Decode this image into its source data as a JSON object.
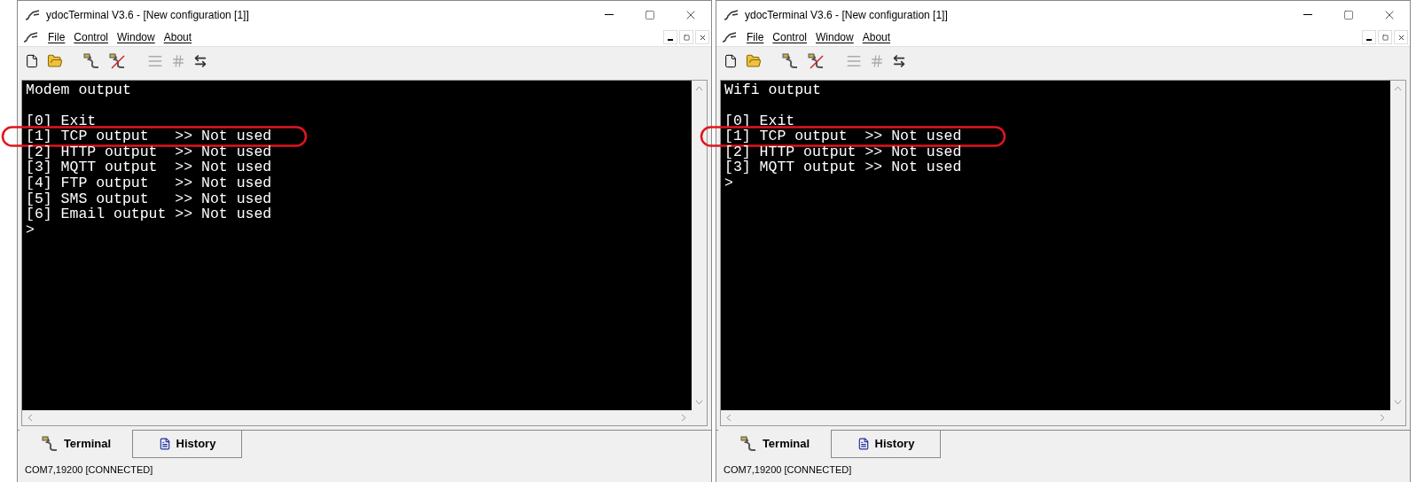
{
  "windows": [
    {
      "title": "ydocTerminal V3.6 - [New configuration [1]]",
      "menu": [
        "File",
        "Control",
        "Window",
        "About"
      ],
      "terminal": {
        "heading": "Modem output",
        "lines": [
          {
            "text": "[0] Exit",
            "circled": false
          },
          {
            "text": "[1] TCP output   >> Not used",
            "circled": true
          },
          {
            "text": "[2] HTTP output  >> Not used",
            "circled": false
          },
          {
            "text": "[3] MQTT output  >> Not used",
            "circled": false
          },
          {
            "text": "[4] FTP output   >> Not used",
            "circled": false
          },
          {
            "text": "[5] SMS output   >> Not used",
            "circled": false
          },
          {
            "text": "[6] Email output >> Not used",
            "circled": false
          }
        ],
        "prompt": ">"
      },
      "tabs": [
        {
          "label": "Terminal",
          "selected": true
        },
        {
          "label": "History",
          "selected": false
        }
      ],
      "status_bar": "COM7,19200 [CONNECTED]"
    },
    {
      "title": "ydocTerminal V3.6 - [New configuration [1]]",
      "menu": [
        "File",
        "Control",
        "Window",
        "About"
      ],
      "terminal": {
        "heading": "Wifi output",
        "lines": [
          {
            "text": "[0] Exit",
            "circled": false
          },
          {
            "text": "[1] TCP output  >> Not used",
            "circled": true
          },
          {
            "text": "[2] HTTP output >> Not used",
            "circled": false
          },
          {
            "text": "[3] MQTT output >> Not used",
            "circled": false
          }
        ],
        "prompt": ">"
      },
      "tabs": [
        {
          "label": "Terminal",
          "selected": true
        },
        {
          "label": "History",
          "selected": false
        }
      ],
      "status_bar": "COM7,19200 [CONNECTED]"
    }
  ]
}
